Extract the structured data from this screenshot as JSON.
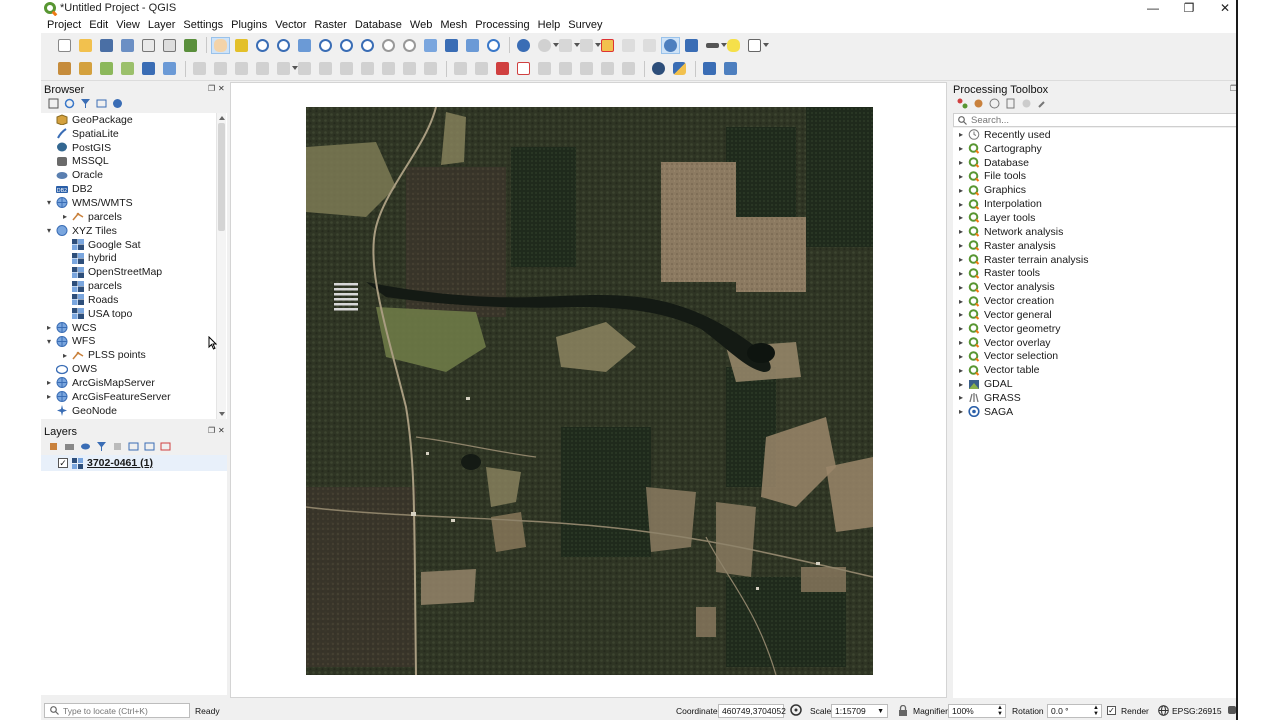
{
  "window": {
    "title": "*Untitled Project - QGIS",
    "minimize_glyph": "—",
    "restore_glyph": "❐",
    "close_glyph": "✕"
  },
  "menubar": [
    "Project",
    "Edit",
    "View",
    "Layer",
    "Settings",
    "Plugins",
    "Vector",
    "Raster",
    "Database",
    "Web",
    "Mesh",
    "Processing",
    "Help",
    "Survey"
  ],
  "browser": {
    "title": "Browser",
    "items": [
      {
        "label": "GeoPackage",
        "indent": 0,
        "arrow": "",
        "icon": "geopackage-icon"
      },
      {
        "label": "SpatiaLite",
        "indent": 0,
        "arrow": "",
        "icon": "spatialite-icon"
      },
      {
        "label": "PostGIS",
        "indent": 0,
        "arrow": "",
        "icon": "postgis-icon"
      },
      {
        "label": "MSSQL",
        "indent": 0,
        "arrow": "",
        "icon": "mssql-icon"
      },
      {
        "label": "Oracle",
        "indent": 0,
        "arrow": "",
        "icon": "oracle-icon"
      },
      {
        "label": "DB2",
        "indent": 0,
        "arrow": "",
        "icon": "db2-icon"
      },
      {
        "label": "WMS/WMTS",
        "indent": 0,
        "arrow": "▾",
        "icon": "globe-icon"
      },
      {
        "label": "parcels",
        "indent": 1,
        "arrow": "▸",
        "icon": "wms-layer-icon"
      },
      {
        "label": "XYZ Tiles",
        "indent": 0,
        "arrow": "▾",
        "icon": "xyz-tiles-icon"
      },
      {
        "label": "Google Sat",
        "indent": 1,
        "arrow": "",
        "icon": "tile-layer-icon"
      },
      {
        "label": "hybrid",
        "indent": 1,
        "arrow": "",
        "icon": "tile-layer-icon"
      },
      {
        "label": "OpenStreetMap",
        "indent": 1,
        "arrow": "",
        "icon": "tile-layer-icon"
      },
      {
        "label": "parcels",
        "indent": 1,
        "arrow": "",
        "icon": "tile-layer-icon"
      },
      {
        "label": "Roads",
        "indent": 1,
        "arrow": "",
        "icon": "tile-layer-icon"
      },
      {
        "label": "USA topo",
        "indent": 1,
        "arrow": "",
        "icon": "tile-layer-icon"
      },
      {
        "label": "WCS",
        "indent": 0,
        "arrow": "▸",
        "icon": "globe-icon"
      },
      {
        "label": "WFS",
        "indent": 0,
        "arrow": "▾",
        "icon": "globe-icon"
      },
      {
        "label": "PLSS points",
        "indent": 1,
        "arrow": "▸",
        "icon": "wfs-layer-icon"
      },
      {
        "label": "OWS",
        "indent": 0,
        "arrow": "",
        "icon": "ows-icon"
      },
      {
        "label": "ArcGisMapServer",
        "indent": 0,
        "arrow": "▸",
        "icon": "globe-icon"
      },
      {
        "label": "ArcGisFeatureServer",
        "indent": 0,
        "arrow": "▸",
        "icon": "globe-icon"
      },
      {
        "label": "GeoNode",
        "indent": 0,
        "arrow": "",
        "icon": "geonode-icon"
      }
    ]
  },
  "layers": {
    "title": "Layers",
    "items": [
      {
        "label": "3702-0461 (1)",
        "checked": true
      }
    ]
  },
  "toolbox": {
    "title": "Processing Toolbox",
    "search_placeholder": "Search...",
    "items": [
      {
        "label": "Recently used",
        "icon": "clock-icon"
      },
      {
        "label": "Cartography",
        "icon": "qgis-algorithm-icon"
      },
      {
        "label": "Database",
        "icon": "qgis-algorithm-icon"
      },
      {
        "label": "File tools",
        "icon": "qgis-algorithm-icon"
      },
      {
        "label": "Graphics",
        "icon": "qgis-algorithm-icon"
      },
      {
        "label": "Interpolation",
        "icon": "qgis-algorithm-icon"
      },
      {
        "label": "Layer tools",
        "icon": "qgis-algorithm-icon"
      },
      {
        "label": "Network analysis",
        "icon": "qgis-algorithm-icon"
      },
      {
        "label": "Raster analysis",
        "icon": "qgis-algorithm-icon"
      },
      {
        "label": "Raster terrain analysis",
        "icon": "qgis-algorithm-icon"
      },
      {
        "label": "Raster tools",
        "icon": "qgis-algorithm-icon"
      },
      {
        "label": "Vector analysis",
        "icon": "qgis-algorithm-icon"
      },
      {
        "label": "Vector creation",
        "icon": "qgis-algorithm-icon"
      },
      {
        "label": "Vector general",
        "icon": "qgis-algorithm-icon"
      },
      {
        "label": "Vector geometry",
        "icon": "qgis-algorithm-icon"
      },
      {
        "label": "Vector overlay",
        "icon": "qgis-algorithm-icon"
      },
      {
        "label": "Vector selection",
        "icon": "qgis-algorithm-icon"
      },
      {
        "label": "Vector table",
        "icon": "qgis-algorithm-icon"
      },
      {
        "label": "GDAL",
        "icon": "gdal-icon"
      },
      {
        "label": "GRASS",
        "icon": "grass-icon"
      },
      {
        "label": "SAGA",
        "icon": "saga-icon"
      }
    ]
  },
  "statusbar": {
    "locator_placeholder": "Type to locate (Ctrl+K)",
    "status": "Ready",
    "coordinate_label": "Coordinate",
    "coordinate_value": "460749,3704052",
    "scale_label": "Scale",
    "scale_value": "1:15709",
    "magnifier_label": "Magnifier",
    "magnifier_value": "100%",
    "rotation_label": "Rotation",
    "rotation_value": "0.0 °",
    "render_label": "Render",
    "crs": "EPSG:26915"
  },
  "colors": {
    "qgis_green": "#589632",
    "qgis_orange": "#ee7913",
    "highlight": "#cfe3f7"
  }
}
